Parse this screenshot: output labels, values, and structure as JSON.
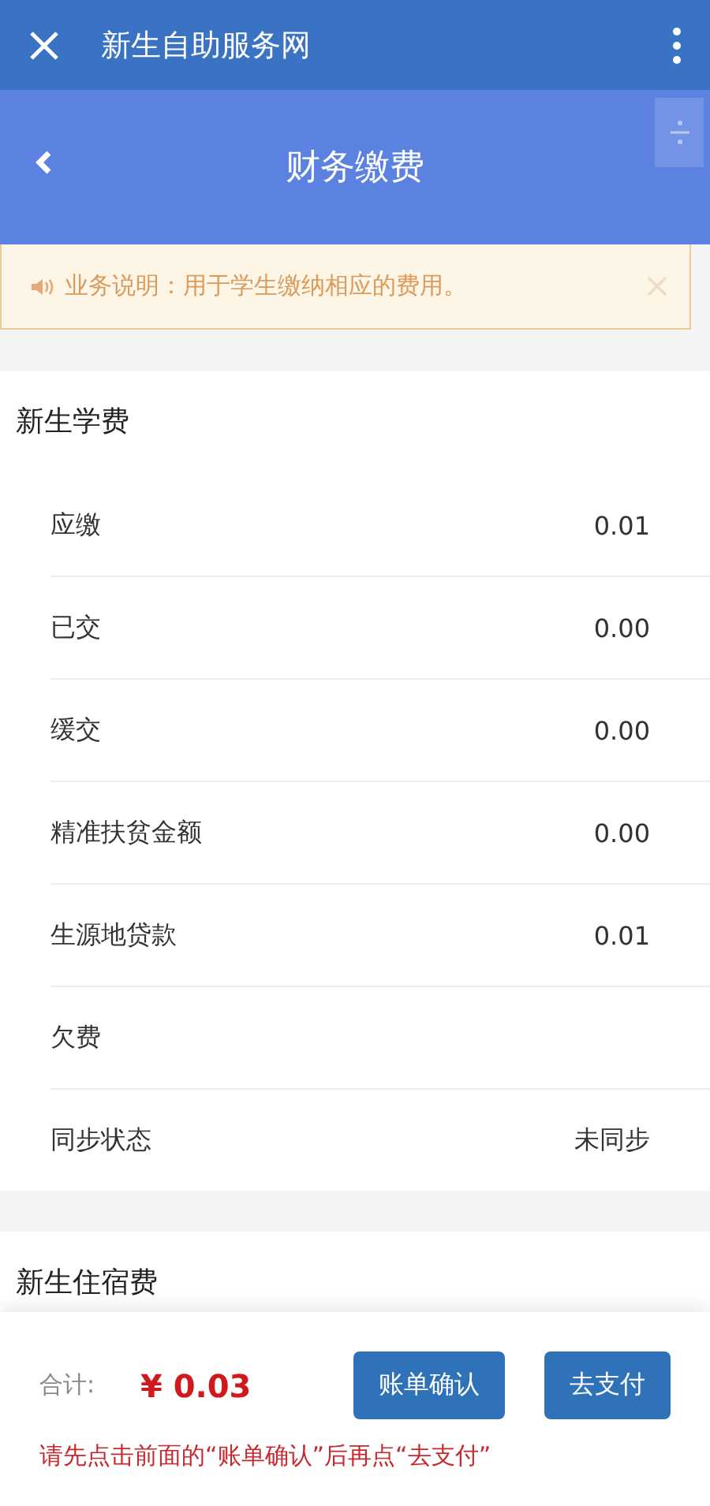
{
  "window": {
    "title": "新生自助服务网"
  },
  "header": {
    "title": "财务缴费"
  },
  "notice": {
    "text": "业务说明：用于学生缴纳相应的费用。"
  },
  "sections": [
    {
      "title": "新生学费",
      "rows": [
        {
          "label": "应缴",
          "value": "0.01"
        },
        {
          "label": "已交",
          "value": "0.00"
        },
        {
          "label": "缓交",
          "value": "0.00"
        },
        {
          "label": "精准扶贫金额",
          "value": "0.00"
        },
        {
          "label": "生源地贷款",
          "value": "0.01"
        },
        {
          "label": "欠费"
        },
        {
          "label": "同步状态",
          "value": "未同步"
        }
      ]
    },
    {
      "title": "新生住宿费"
    }
  ],
  "footer": {
    "total_label": "合计:",
    "total": "¥ 0.03",
    "buttons": [
      "账单确认",
      "去支付"
    ],
    "hint": "请先点击前面的“账单确认”后再点“去支付”"
  }
}
